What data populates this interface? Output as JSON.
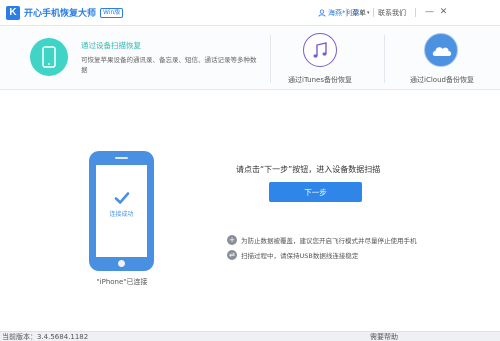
{
  "titlebar": {
    "app_title": "开心手机恢复大师",
    "edition": "Win版",
    "user_name": "海燕*利尔",
    "menu_label": "菜单",
    "contact_label": "联系我们",
    "minimize": "—",
    "close": "✕"
  },
  "modes": {
    "device_scan": {
      "title": "通过设备扫描恢复",
      "desc": "可恢复苹果设备的通讯录、备忘录、短信、通话记录等多种数据"
    },
    "itunes": {
      "label": "通过iTunes备份恢复",
      "icon": "music-note-icon"
    },
    "icloud": {
      "label": "通过iCloud备份恢复",
      "icon": "cloud-icon"
    }
  },
  "device": {
    "status_on_screen": "连接成功",
    "label": "\"iPhone\"已连接"
  },
  "main": {
    "instruction": "请点击“下一步”按钮，进入设备数据扫描",
    "next_button": "下一步"
  },
  "tips": [
    {
      "icon": "plus-icon",
      "text": "为防止数据被覆盖，建议您开启飞行模式并尽量停止使用手机"
    },
    {
      "icon": "usb-icon",
      "text": "扫描过程中，请保持USB数据线连接稳定"
    }
  ],
  "status": {
    "version": "当前版本：3.4.5684.1182",
    "help": "需要帮助"
  },
  "colors": {
    "accent": "#2f86e8",
    "teal": "#3fd4c6",
    "purple": "#7a5ccf",
    "phone": "#4a90e2"
  }
}
